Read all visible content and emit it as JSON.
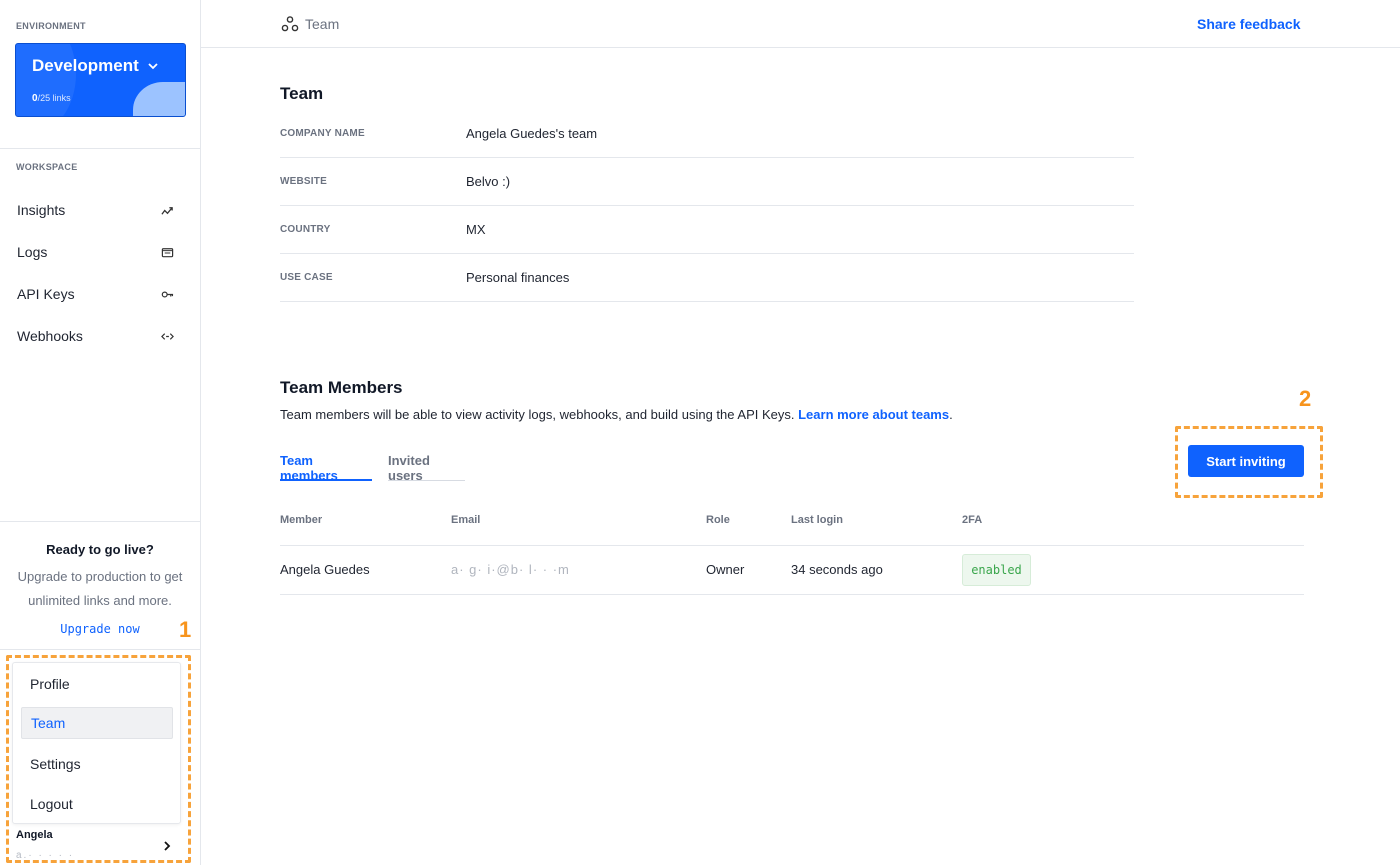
{
  "sidebar": {
    "environment_label": "ENVIRONMENT",
    "environment": {
      "name": "Development",
      "links_used": "0",
      "links_total": "/25 links"
    },
    "workspace_label": "WORKSPACE",
    "nav": [
      {
        "label": "Insights",
        "icon": "insights-chart-icon"
      },
      {
        "label": "Logs",
        "icon": "folder-icon"
      },
      {
        "label": "API Keys",
        "icon": "key-icon"
      },
      {
        "label": "Webhooks",
        "icon": "code-arrows-icon"
      }
    ],
    "golive": {
      "title": "Ready to go live?",
      "text": "Upgrade to production to get unlimited links and more.",
      "cta": "Upgrade now"
    },
    "user_menu": {
      "items": [
        "Profile",
        "Team",
        "Settings",
        "Logout"
      ],
      "active_index": 1
    },
    "user": {
      "name": "Angela",
      "email_masked": "a.· ·  · · ·"
    }
  },
  "header": {
    "breadcrumb": "Team",
    "feedback": "Share feedback"
  },
  "team": {
    "title": "Team",
    "fields": [
      {
        "label": "COMPANY NAME",
        "value": "Angela Guedes's team"
      },
      {
        "label": "WEBSITE",
        "value": "Belvo :)"
      },
      {
        "label": "COUNTRY",
        "value": "MX"
      },
      {
        "label": "USE CASE",
        "value": "Personal finances"
      }
    ]
  },
  "members": {
    "title": "Team Members",
    "description": "Team members will be able to view activity logs, webhooks, and build using the API Keys.",
    "learn_more": "Learn more about teams",
    "learn_more_suffix": ".",
    "tabs": [
      "Team members",
      "Invited users"
    ],
    "invite_button": "Start inviting",
    "columns": [
      "Member",
      "Email",
      "Role",
      "Last login",
      "2FA"
    ],
    "rows": [
      {
        "member": "Angela Guedes",
        "email": "a· g· i·@b· l·  ·  ·m",
        "role": "Owner",
        "last_login": "34 seconds ago",
        "twofa": "enabled"
      }
    ]
  },
  "annotations": [
    "1",
    "2"
  ],
  "colors": {
    "primary": "#0f62fe",
    "annotation": "#f7941d",
    "badge_green": "#3aa64c"
  }
}
